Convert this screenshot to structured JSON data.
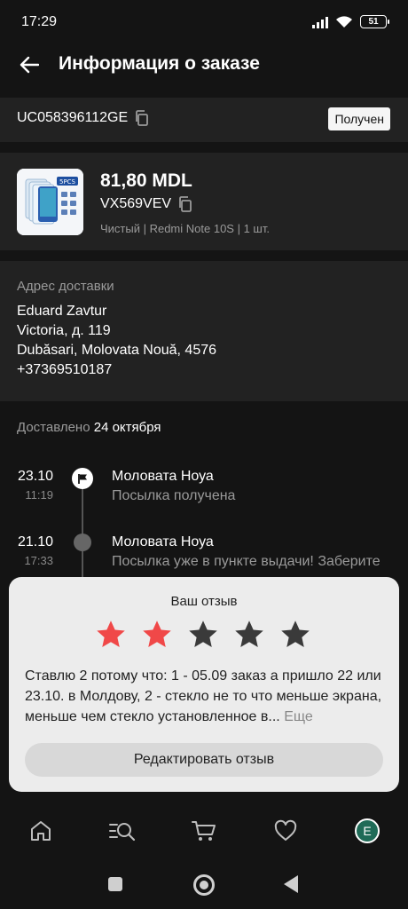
{
  "status_bar": {
    "time": "17:29",
    "battery": "51"
  },
  "header": {
    "title": "Информация о заказе"
  },
  "order": {
    "id": "UC058396112GE",
    "status": "Получен"
  },
  "product": {
    "price": "81,80 MDL",
    "sku": "VX569VEV",
    "variant": "Чистый | Redmi Note 10S | 1 шт.",
    "thumb_label": "5PCS"
  },
  "address": {
    "label": "Адрес доставки",
    "name": "Eduard Zavtur",
    "street": "Victoria, д. 119",
    "city": "Dubăsari, Molovata Nouă, 4576",
    "phone": "+37369510187"
  },
  "delivered": {
    "label": "Доставлено",
    "date": "24 октября"
  },
  "timeline": [
    {
      "date": "23.10",
      "time": "11:19",
      "place": "Моловата Ноуа",
      "desc": "Посылка получена"
    },
    {
      "date": "21.10",
      "time": "17:33",
      "place": "Моловата Ноуа",
      "desc": "Посылка уже в пункте выдачи! Заберите"
    }
  ],
  "review": {
    "title": "Ваш отзыв",
    "rating": 2,
    "max_rating": 5,
    "text": "Ставлю 2 потому что: 1 - 05.09 заказ а пришло 22 или 23.10. в Молдову, 2 - стекло не то что меньше экрана, меньше чем стекло установленное в...",
    "more": "Еще",
    "edit_button": "Редактировать отзыв",
    "star_active_color": "#f04848",
    "star_inactive_color": "#3a3a3a"
  },
  "bottom_nav": {
    "icons": [
      "home-icon",
      "search-list-icon",
      "cart-icon",
      "heart-icon",
      "avatar"
    ],
    "avatar_letter": "E"
  }
}
